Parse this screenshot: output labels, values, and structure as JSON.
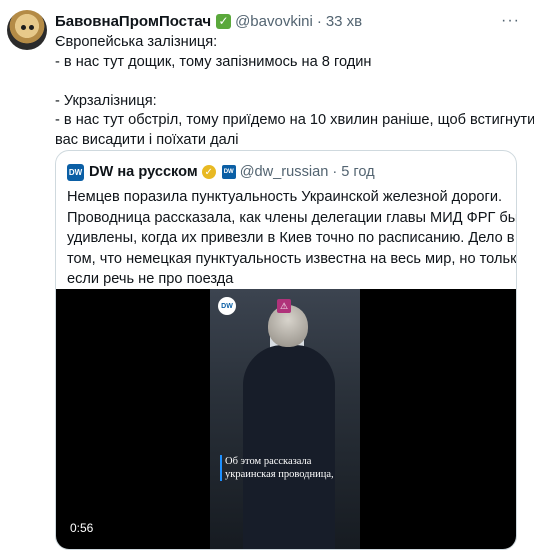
{
  "tweet": {
    "author_name": "БавовнаПромПостач",
    "verified_icon": "green-check-icon",
    "handle": "@bavovkini",
    "separator": "·",
    "time": "33 хв",
    "more_label": "···",
    "text_lines": [
      "Європейська залізниця:",
      "- в нас тут дощик, тому запізнимось на 8 годин",
      "",
      "- Укрзалізниця:",
      "- в нас тут обстріл, тому приїдемо на 10 хвилин раніше, щоб встигнути",
      "вас висадити і поїхати далі"
    ]
  },
  "quote": {
    "avatar_text": "DW",
    "author_name": "DW на русском",
    "badge_icon": "gold-verified-icon",
    "affiliate_text": "DW",
    "handle": "@dw_russian",
    "separator": "·",
    "time": "5 год",
    "text_lines": [
      "Немцев поразила пунктуальность Украинской железной дороги.",
      "Проводница рассказала, как члены делегации главы МИД ФРГ были",
      "удивлены, когда их привезли в Киев точно по расписанию. Дело в",
      "том, что немецкая пунктуальность известна на весь мир, но только",
      "если речь не про поезда"
    ],
    "video": {
      "logo_text": "DW",
      "caption_lines": [
        "Об этом рассказала",
        "украинская проводница,"
      ],
      "duration": "0:56"
    }
  },
  "colors": {
    "text": "#0f1419",
    "muted": "#536471",
    "border": "#cfd9de",
    "verified_green": "#5aa83b",
    "dw_blue": "#0b5fa5"
  }
}
